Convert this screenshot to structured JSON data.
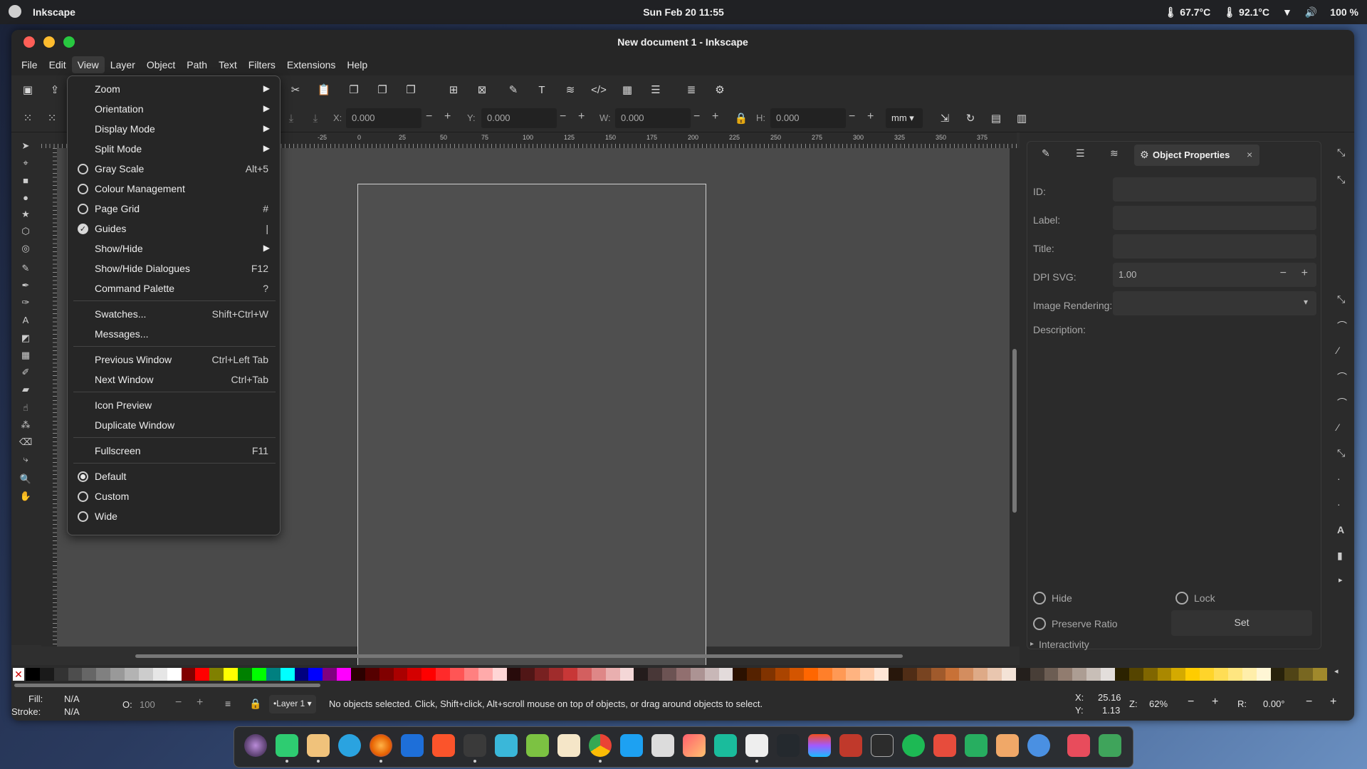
{
  "system_bar": {
    "app_name": "Inkscape",
    "clock": "Sun Feb 20  11:55",
    "temp1": "67.7°C",
    "temp2": "92.1°C",
    "battery": "100 %"
  },
  "window": {
    "title": "New document 1 - Inkscape"
  },
  "menubar": [
    "File",
    "Edit",
    "View",
    "Layer",
    "Object",
    "Path",
    "Text",
    "Filters",
    "Extensions",
    "Help"
  ],
  "view_menu": {
    "zoom": "Zoom",
    "orientation": "Orientation",
    "display_mode": "Display Mode",
    "split_mode": "Split Mode",
    "gray_scale": "Gray Scale",
    "gray_scale_acc": "Alt+5",
    "colour_management": "Colour Management",
    "page_grid": "Page Grid",
    "page_grid_acc": "#",
    "guides": "Guides",
    "guides_acc": "|",
    "show_hide": "Show/Hide",
    "show_hide_dialogues": "Show/Hide Dialogues",
    "show_hide_dialogues_acc": "F12",
    "command_palette": "Command Palette",
    "command_palette_acc": "?",
    "swatches": "Swatches...",
    "swatches_acc": "Shift+Ctrl+W",
    "messages": "Messages...",
    "previous_window": "Previous Window",
    "previous_window_acc": "Ctrl+Left Tab",
    "next_window": "Next Window",
    "next_window_acc": "Ctrl+Tab",
    "icon_preview": "Icon Preview",
    "duplicate_window": "Duplicate Window",
    "fullscreen": "Fullscreen",
    "fullscreen_acc": "F11",
    "default": "Default",
    "custom": "Custom",
    "wide": "Wide"
  },
  "toolbar2": {
    "x_label": "X:",
    "x_value": "0.000",
    "y_label": "Y:",
    "y_value": "0.000",
    "w_label": "W:",
    "w_value": "0.000",
    "h_label": "H:",
    "h_value": "0.000",
    "unit": "mm"
  },
  "ruler": [
    "-25",
    "0",
    "25",
    "50",
    "75",
    "100",
    "125",
    "150",
    "175",
    "200",
    "225",
    "250",
    "275",
    "300",
    "325",
    "350",
    "375"
  ],
  "object_properties": {
    "tab_title": "Object Properties",
    "id_label": "ID:",
    "label_label": "Label:",
    "title_label": "Title:",
    "dpi_label": "DPI SVG:",
    "dpi_value": "1.00",
    "image_rendering_label": "Image Rendering:",
    "description_label": "Description:",
    "hide_label": "Hide",
    "lock_label": "Lock",
    "preserve_ratio_label": "Preserve Ratio",
    "set_button": "Set",
    "interactivity_label": "Interactivity"
  },
  "status": {
    "fill_label": "Fill:",
    "fill_value": "N/A",
    "stroke_label": "Stroke:",
    "stroke_value": "N/A",
    "opacity_label": "O:",
    "opacity_value": "100",
    "layer": "•Layer 1",
    "message": "No objects selected. Click, Shift+click, Alt+scroll mouse on top of objects, or drag around objects to select.",
    "x_label": "X:",
    "x_value": "25.16",
    "y_label": "Y:",
    "y_value": "1.13",
    "zoom_label": "Z:",
    "zoom_value": "62%",
    "rotation_label": "R:",
    "rotation_value": "0.00°"
  },
  "palette_colors": [
    "#000000",
    "#1a1a1a",
    "#333333",
    "#4d4d4d",
    "#666666",
    "#808080",
    "#999999",
    "#b3b3b3",
    "#cccccc",
    "#e6e6e6",
    "#ffffff",
    "#800000",
    "#ff0000",
    "#808000",
    "#ffff00",
    "#008000",
    "#00ff00",
    "#008080",
    "#00ffff",
    "#000080",
    "#0000ff",
    "#800080",
    "#ff00ff",
    "#2b0000",
    "#550000",
    "#800000",
    "#aa0000",
    "#d40000",
    "#ff0000",
    "#ff2a2a",
    "#ff5555",
    "#ff8080",
    "#ffaaaa",
    "#ffd5d5",
    "#280b0b",
    "#501616",
    "#782121",
    "#a02c2c",
    "#c83737",
    "#d35f5f",
    "#de8787",
    "#e9afaf",
    "#f4d7d7",
    "#241c1c",
    "#483737",
    "#6c5353",
    "#916f6f",
    "#ac9393",
    "#c8b7b7",
    "#e3dbdb",
    "#2b1100",
    "#552200",
    "#803300",
    "#aa4400",
    "#d45500",
    "#ff6600",
    "#ff7f2a",
    "#ff9955",
    "#ffb380",
    "#ffccaa",
    "#ffe6d5",
    "#28170b",
    "#502d16",
    "#784421",
    "#a05a2c",
    "#c87137",
    "#d38d5f",
    "#deaa87",
    "#e9c6af",
    "#f4e3d7",
    "#241f1c",
    "#483e37",
    "#6c5d53",
    "#917c6f",
    "#ac9d93",
    "#c8beb7",
    "#e3dedb",
    "#2b2200",
    "#554400",
    "#806600",
    "#aa8800",
    "#d4aa00",
    "#ffcc00",
    "#ffd42a",
    "#ffdd55",
    "#ffe680",
    "#ffeeaa",
    "#fff6d5",
    "#28220b",
    "#504416",
    "#786721",
    "#a0892c"
  ]
}
